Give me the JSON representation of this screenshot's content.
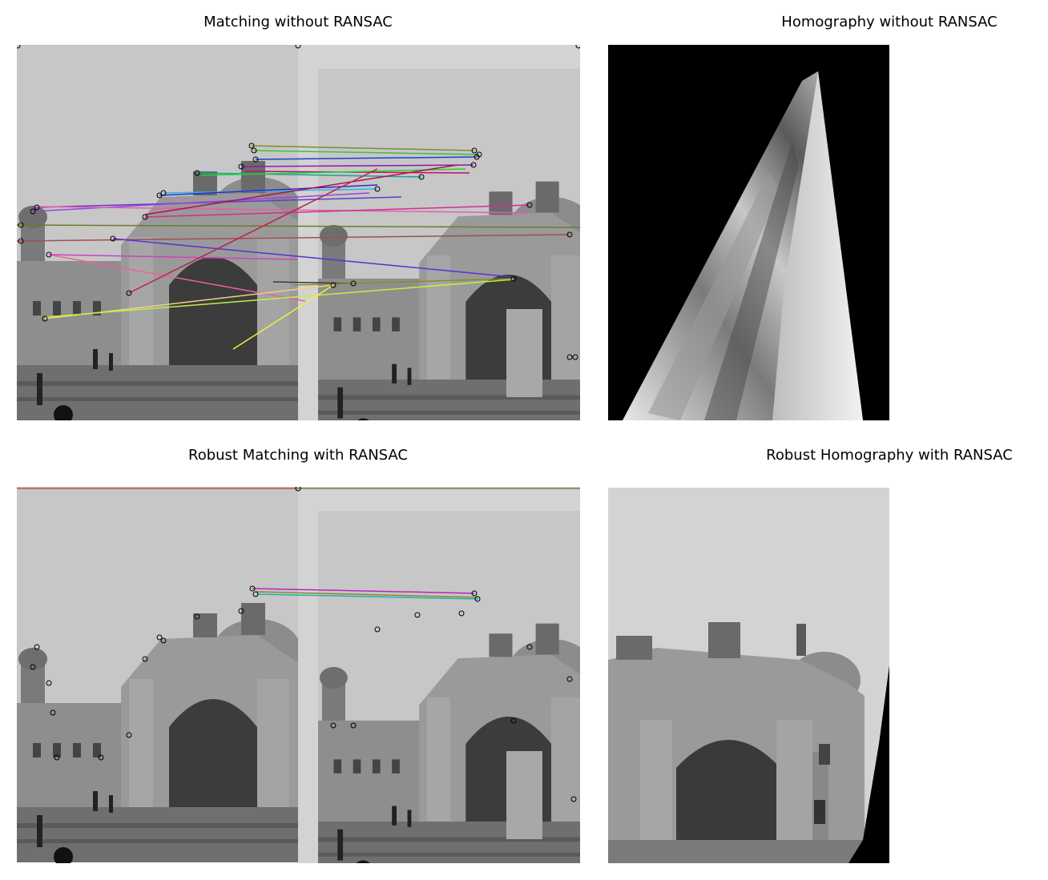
{
  "titles": {
    "top_left": "Matching without RANSAC",
    "top_right": "Homography without RANSAC",
    "bottom_left": "Robust Matching with RANSAC",
    "bottom_right": "Robust Homography with RANSAC"
  },
  "colors": {
    "background": "#ffffff",
    "sky_left": "#c2c2c2",
    "sky_right": "#d3d3d3",
    "building_stone": "#8a8a8a",
    "warp_void": "#000000",
    "keypoint_stroke": "#000000"
  },
  "icons": {
    "keypoint": "keypoint-circle-icon"
  }
}
